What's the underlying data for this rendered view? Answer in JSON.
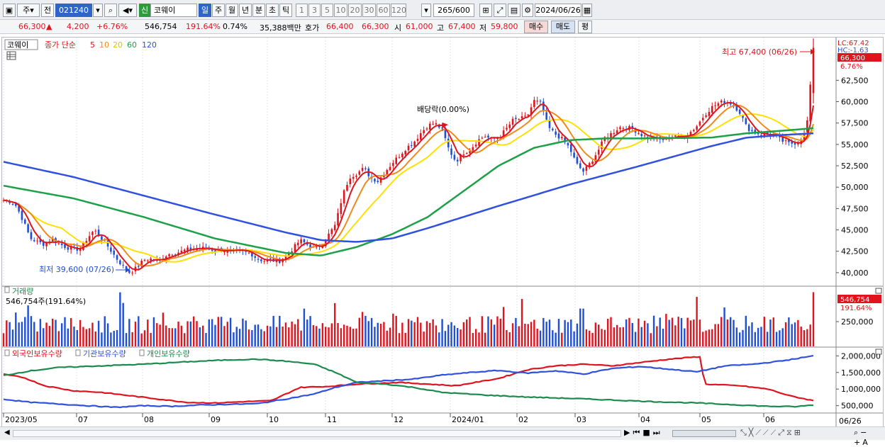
{
  "toolbar": {
    "period_main": "주",
    "prefix": "전",
    "code": "021240",
    "credit": "신",
    "name": "코웨이",
    "periods": [
      "일",
      "주",
      "월",
      "년",
      "분",
      "초",
      "틱"
    ],
    "active_period": "일",
    "minutes": [
      "1",
      "3",
      "5",
      "10",
      "20",
      "30",
      "60",
      "120"
    ],
    "count": "265",
    "count_total": "/600",
    "date": "2024/06/26"
  },
  "info": {
    "price": "66,300",
    "change": "4,200",
    "change_pct": "+6.76%",
    "volume": "546,754",
    "vol_ratio": "191.64%",
    "turnover": "0.74%",
    "amount": "35,388백만",
    "ask_label": "호가",
    "ask": "66,400",
    "bid": "66,300",
    "open_label": "시",
    "open": "61,000",
    "high_label": "고",
    "high": "67,400",
    "low_label": "저",
    "low": "59,800",
    "buy": "매수",
    "sell": "매도",
    "eval": "평"
  },
  "price_panel": {
    "stock": "코웨이",
    "legend_label": "종가 단순",
    "ma_periods": [
      "5",
      "10",
      "20",
      "60",
      "120"
    ],
    "ma_colors": [
      "#e0141e",
      "#f08a1a",
      "#ffe000",
      "#1ca048",
      "#3050e0"
    ],
    "lc": "LC:67.42",
    "hc": "HC:-1.63",
    "last_price": "66,300",
    "last_pct": "6.76%",
    "high_note": "최고 67,400 (06/26)",
    "low_note": "최저 39,600 (07/26)",
    "dividend": "배당락(0.00%)",
    "y_ticks": [
      "62,500",
      "60,000",
      "57,500",
      "55,000",
      "52,500",
      "50,000",
      "47,500",
      "45,000",
      "42,500",
      "40,000"
    ]
  },
  "volume_panel": {
    "title": "거래량",
    "value": "546,754주(191.64%)",
    "last_value": "546,754",
    "last_pct": "191.64%",
    "y_tick": "250,000"
  },
  "holdings_panel": {
    "series": [
      "외국인보유수량",
      "기관보유수량",
      "개인보유수량"
    ],
    "colors": [
      "#e0141e",
      "#3050e0",
      "#1c8a4c"
    ],
    "y_ticks": [
      "2,000,000",
      "1,500,000",
      "1,000,000",
      "500,000"
    ]
  },
  "x_axis": {
    "labels": [
      "2023/05",
      "07",
      "08",
      "09",
      "10",
      "11",
      "12",
      "2024/01",
      "02",
      "03",
      "04",
      "05",
      "06"
    ],
    "end_label": "06/26"
  },
  "chart_data": {
    "type": "candlestick",
    "title": "",
    "date_range": [
      "2023/05",
      "2024/06/26"
    ],
    "x_labels": [
      "2023/05",
      "07",
      "08",
      "09",
      "10",
      "11",
      "12",
      "2024/01",
      "02",
      "03",
      "04",
      "05",
      "06"
    ],
    "ylim": [
      38500,
      67500
    ],
    "close_path": [
      [
        0,
        48500
      ],
      [
        12,
        48300
      ],
      [
        20,
        47800
      ],
      [
        30,
        46000
      ],
      [
        40,
        44000
      ],
      [
        50,
        43600
      ],
      [
        60,
        43300
      ],
      [
        70,
        44000
      ],
      [
        80,
        43400
      ],
      [
        90,
        43000
      ],
      [
        100,
        42700
      ],
      [
        110,
        42800
      ],
      [
        120,
        44000
      ],
      [
        130,
        45000
      ],
      [
        140,
        44000
      ],
      [
        150,
        43000
      ],
      [
        160,
        41800
      ],
      [
        170,
        40800
      ],
      [
        180,
        40000
      ],
      [
        190,
        40600
      ],
      [
        200,
        41500
      ],
      [
        210,
        41600
      ],
      [
        220,
        41300
      ],
      [
        230,
        42000
      ],
      [
        240,
        42300
      ],
      [
        250,
        42400
      ],
      [
        260,
        42700
      ],
      [
        270,
        42800
      ],
      [
        280,
        42900
      ],
      [
        290,
        42800
      ],
      [
        300,
        42600
      ],
      [
        310,
        42700
      ],
      [
        320,
        42400
      ],
      [
        330,
        42500
      ],
      [
        340,
        42400
      ],
      [
        350,
        42300
      ],
      [
        360,
        41600
      ],
      [
        370,
        41400
      ],
      [
        380,
        41500
      ],
      [
        390,
        41300
      ],
      [
        400,
        42000
      ],
      [
        410,
        42800
      ],
      [
        420,
        43800
      ],
      [
        430,
        43300
      ],
      [
        440,
        42900
      ],
      [
        450,
        43200
      ],
      [
        460,
        44400
      ],
      [
        470,
        45600
      ],
      [
        480,
        49000
      ],
      [
        490,
        51200
      ],
      [
        500,
        51600
      ],
      [
        510,
        52200
      ],
      [
        520,
        51100
      ],
      [
        530,
        50700
      ],
      [
        540,
        51800
      ],
      [
        550,
        52800
      ],
      [
        560,
        53700
      ],
      [
        570,
        54600
      ],
      [
        580,
        55200
      ],
      [
        590,
        56300
      ],
      [
        600,
        57200
      ],
      [
        610,
        57500
      ],
      [
        620,
        56800
      ],
      [
        630,
        54400
      ],
      [
        640,
        53000
      ],
      [
        650,
        54000
      ],
      [
        660,
        54400
      ],
      [
        670,
        55400
      ],
      [
        680,
        56000
      ],
      [
        690,
        55600
      ],
      [
        700,
        55800
      ],
      [
        710,
        56700
      ],
      [
        720,
        57800
      ],
      [
        730,
        58000
      ],
      [
        740,
        58200
      ],
      [
        750,
        60100
      ],
      [
        760,
        59800
      ],
      [
        770,
        57000
      ],
      [
        780,
        56200
      ],
      [
        790,
        55600
      ],
      [
        800,
        54600
      ],
      [
        810,
        52700
      ],
      [
        820,
        51800
      ],
      [
        830,
        52900
      ],
      [
        840,
        54200
      ],
      [
        850,
        55800
      ],
      [
        860,
        56300
      ],
      [
        870,
        57000
      ],
      [
        880,
        57000
      ],
      [
        890,
        56800
      ],
      [
        900,
        56200
      ],
      [
        910,
        55800
      ],
      [
        920,
        55700
      ],
      [
        930,
        55500
      ],
      [
        940,
        55800
      ],
      [
        950,
        56100
      ],
      [
        960,
        55800
      ],
      [
        970,
        56400
      ],
      [
        980,
        57200
      ],
      [
        990,
        58400
      ],
      [
        1000,
        59300
      ],
      [
        1010,
        59800
      ],
      [
        1020,
        60100
      ],
      [
        1030,
        59700
      ],
      [
        1040,
        58800
      ],
      [
        1050,
        57000
      ],
      [
        1060,
        56400
      ],
      [
        1070,
        56200
      ],
      [
        1080,
        56200
      ],
      [
        1090,
        56000
      ],
      [
        1100,
        55400
      ],
      [
        1110,
        55100
      ],
      [
        1120,
        55200
      ],
      [
        1130,
        55800
      ],
      [
        1136,
        58000
      ],
      [
        1140,
        61500
      ],
      [
        1144,
        66300
      ]
    ],
    "ma60_path": [
      [
        0,
        50200
      ],
      [
        100,
        48700
      ],
      [
        200,
        46500
      ],
      [
        300,
        44000
      ],
      [
        400,
        42300
      ],
      [
        450,
        42000
      ],
      [
        500,
        43000
      ],
      [
        550,
        44500
      ],
      [
        600,
        46500
      ],
      [
        650,
        49500
      ],
      [
        700,
        52500
      ],
      [
        750,
        54600
      ],
      [
        800,
        55500
      ],
      [
        850,
        55700
      ],
      [
        900,
        55700
      ],
      [
        1000,
        55800
      ],
      [
        1050,
        56300
      ],
      [
        1100,
        56600
      ],
      [
        1144,
        56900
      ]
    ],
    "ma120_path": [
      [
        0,
        53000
      ],
      [
        100,
        51200
      ],
      [
        200,
        49000
      ],
      [
        300,
        46800
      ],
      [
        400,
        44700
      ],
      [
        450,
        43800
      ],
      [
        500,
        43600
      ],
      [
        550,
        44000
      ],
      [
        600,
        45200
      ],
      [
        700,
        47800
      ],
      [
        800,
        50300
      ],
      [
        900,
        52500
      ],
      [
        1000,
        54800
      ],
      [
        1050,
        55800
      ],
      [
        1100,
        56100
      ],
      [
        1144,
        56300
      ]
    ],
    "volume_panel": {
      "ylim": [
        0,
        600000
      ],
      "last": 546754,
      "last_pct": 191.64
    },
    "holdings": [
      {
        "name": "외국인보유수량",
        "points": [
          [
            0,
            1450000
          ],
          [
            30,
            1350000
          ],
          [
            60,
            1100000
          ],
          [
            100,
            950000
          ],
          [
            140,
            900000
          ],
          [
            180,
            800000
          ],
          [
            220,
            700000
          ],
          [
            260,
            600000
          ],
          [
            300,
            580000
          ],
          [
            340,
            620000
          ],
          [
            380,
            650000
          ],
          [
            420,
            1050000
          ],
          [
            460,
            1080000
          ],
          [
            500,
            1150000
          ],
          [
            560,
            1200000
          ],
          [
            600,
            1150000
          ],
          [
            640,
            1100000
          ],
          [
            700,
            1320000
          ],
          [
            740,
            1580000
          ],
          [
            780,
            1700000
          ],
          [
            820,
            1750000
          ],
          [
            860,
            1700000
          ],
          [
            900,
            1800000
          ],
          [
            940,
            1900000
          ],
          [
            985,
            1980000
          ],
          [
            990,
            1150000
          ],
          [
            1040,
            1100000
          ],
          [
            1080,
            1000000
          ],
          [
            1110,
            800000
          ],
          [
            1144,
            650000
          ]
        ]
      },
      {
        "name": "기관보유수량",
        "points": [
          [
            0,
            700000
          ],
          [
            40,
            600000
          ],
          [
            80,
            550000
          ],
          [
            120,
            500000
          ],
          [
            160,
            450000
          ],
          [
            200,
            500000
          ],
          [
            240,
            480000
          ],
          [
            280,
            520000
          ],
          [
            320,
            540000
          ],
          [
            360,
            560000
          ],
          [
            400,
            700000
          ],
          [
            440,
            850000
          ],
          [
            470,
            1050000
          ],
          [
            500,
            1200000
          ],
          [
            540,
            1250000
          ],
          [
            580,
            1300000
          ],
          [
            620,
            1420000
          ],
          [
            660,
            1500000
          ],
          [
            700,
            1560000
          ],
          [
            740,
            1480000
          ],
          [
            780,
            1550000
          ],
          [
            820,
            1450000
          ],
          [
            860,
            1620000
          ],
          [
            900,
            1680000
          ],
          [
            940,
            1600000
          ],
          [
            980,
            1520000
          ],
          [
            1020,
            1700000
          ],
          [
            1060,
            1750000
          ],
          [
            1100,
            1850000
          ],
          [
            1144,
            2000000
          ]
        ]
      },
      {
        "name": "개인보유수량",
        "points": [
          [
            0,
            1400000
          ],
          [
            40,
            1550000
          ],
          [
            80,
            1650000
          ],
          [
            140,
            1700000
          ],
          [
            200,
            1750000
          ],
          [
            260,
            1820000
          ],
          [
            320,
            1880000
          ],
          [
            360,
            1900000
          ],
          [
            400,
            1840000
          ],
          [
            440,
            1750000
          ],
          [
            470,
            1500000
          ],
          [
            500,
            1200000
          ],
          [
            540,
            1150000
          ],
          [
            580,
            1050000
          ],
          [
            620,
            900000
          ],
          [
            680,
            820000
          ],
          [
            740,
            760000
          ],
          [
            800,
            720000
          ],
          [
            860,
            670000
          ],
          [
            920,
            620000
          ],
          [
            980,
            580000
          ],
          [
            1040,
            520000
          ],
          [
            1080,
            480000
          ],
          [
            1120,
            470000
          ],
          [
            1144,
            520000
          ]
        ]
      }
    ],
    "holdings_ylim": [
      300000,
      2200000
    ],
    "annotations": [
      "최고 67,400 (06/26)",
      "최저 39,600 (07/26)",
      "배당락(0.00%)"
    ]
  }
}
